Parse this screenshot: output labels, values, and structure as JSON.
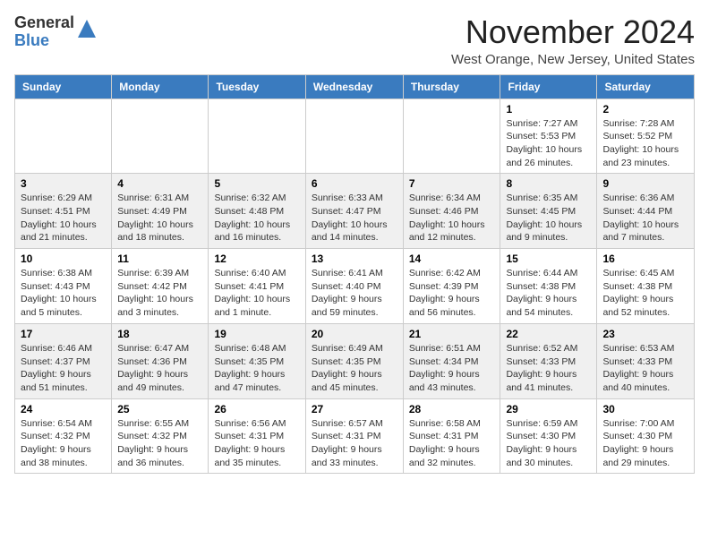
{
  "logo": {
    "line1": "General",
    "line2": "Blue"
  },
  "title": "November 2024",
  "subtitle": "West Orange, New Jersey, United States",
  "days_of_week": [
    "Sunday",
    "Monday",
    "Tuesday",
    "Wednesday",
    "Thursday",
    "Friday",
    "Saturday"
  ],
  "weeks": [
    [
      {
        "day": "",
        "info": ""
      },
      {
        "day": "",
        "info": ""
      },
      {
        "day": "",
        "info": ""
      },
      {
        "day": "",
        "info": ""
      },
      {
        "day": "",
        "info": ""
      },
      {
        "day": "1",
        "info": "Sunrise: 7:27 AM\nSunset: 5:53 PM\nDaylight: 10 hours and 26 minutes."
      },
      {
        "day": "2",
        "info": "Sunrise: 7:28 AM\nSunset: 5:52 PM\nDaylight: 10 hours and 23 minutes."
      }
    ],
    [
      {
        "day": "3",
        "info": "Sunrise: 6:29 AM\nSunset: 4:51 PM\nDaylight: 10 hours and 21 minutes."
      },
      {
        "day": "4",
        "info": "Sunrise: 6:31 AM\nSunset: 4:49 PM\nDaylight: 10 hours and 18 minutes."
      },
      {
        "day": "5",
        "info": "Sunrise: 6:32 AM\nSunset: 4:48 PM\nDaylight: 10 hours and 16 minutes."
      },
      {
        "day": "6",
        "info": "Sunrise: 6:33 AM\nSunset: 4:47 PM\nDaylight: 10 hours and 14 minutes."
      },
      {
        "day": "7",
        "info": "Sunrise: 6:34 AM\nSunset: 4:46 PM\nDaylight: 10 hours and 12 minutes."
      },
      {
        "day": "8",
        "info": "Sunrise: 6:35 AM\nSunset: 4:45 PM\nDaylight: 10 hours and 9 minutes."
      },
      {
        "day": "9",
        "info": "Sunrise: 6:36 AM\nSunset: 4:44 PM\nDaylight: 10 hours and 7 minutes."
      }
    ],
    [
      {
        "day": "10",
        "info": "Sunrise: 6:38 AM\nSunset: 4:43 PM\nDaylight: 10 hours and 5 minutes."
      },
      {
        "day": "11",
        "info": "Sunrise: 6:39 AM\nSunset: 4:42 PM\nDaylight: 10 hours and 3 minutes."
      },
      {
        "day": "12",
        "info": "Sunrise: 6:40 AM\nSunset: 4:41 PM\nDaylight: 10 hours and 1 minute."
      },
      {
        "day": "13",
        "info": "Sunrise: 6:41 AM\nSunset: 4:40 PM\nDaylight: 9 hours and 59 minutes."
      },
      {
        "day": "14",
        "info": "Sunrise: 6:42 AM\nSunset: 4:39 PM\nDaylight: 9 hours and 56 minutes."
      },
      {
        "day": "15",
        "info": "Sunrise: 6:44 AM\nSunset: 4:38 PM\nDaylight: 9 hours and 54 minutes."
      },
      {
        "day": "16",
        "info": "Sunrise: 6:45 AM\nSunset: 4:38 PM\nDaylight: 9 hours and 52 minutes."
      }
    ],
    [
      {
        "day": "17",
        "info": "Sunrise: 6:46 AM\nSunset: 4:37 PM\nDaylight: 9 hours and 51 minutes."
      },
      {
        "day": "18",
        "info": "Sunrise: 6:47 AM\nSunset: 4:36 PM\nDaylight: 9 hours and 49 minutes."
      },
      {
        "day": "19",
        "info": "Sunrise: 6:48 AM\nSunset: 4:35 PM\nDaylight: 9 hours and 47 minutes."
      },
      {
        "day": "20",
        "info": "Sunrise: 6:49 AM\nSunset: 4:35 PM\nDaylight: 9 hours and 45 minutes."
      },
      {
        "day": "21",
        "info": "Sunrise: 6:51 AM\nSunset: 4:34 PM\nDaylight: 9 hours and 43 minutes."
      },
      {
        "day": "22",
        "info": "Sunrise: 6:52 AM\nSunset: 4:33 PM\nDaylight: 9 hours and 41 minutes."
      },
      {
        "day": "23",
        "info": "Sunrise: 6:53 AM\nSunset: 4:33 PM\nDaylight: 9 hours and 40 minutes."
      }
    ],
    [
      {
        "day": "24",
        "info": "Sunrise: 6:54 AM\nSunset: 4:32 PM\nDaylight: 9 hours and 38 minutes."
      },
      {
        "day": "25",
        "info": "Sunrise: 6:55 AM\nSunset: 4:32 PM\nDaylight: 9 hours and 36 minutes."
      },
      {
        "day": "26",
        "info": "Sunrise: 6:56 AM\nSunset: 4:31 PM\nDaylight: 9 hours and 35 minutes."
      },
      {
        "day": "27",
        "info": "Sunrise: 6:57 AM\nSunset: 4:31 PM\nDaylight: 9 hours and 33 minutes."
      },
      {
        "day": "28",
        "info": "Sunrise: 6:58 AM\nSunset: 4:31 PM\nDaylight: 9 hours and 32 minutes."
      },
      {
        "day": "29",
        "info": "Sunrise: 6:59 AM\nSunset: 4:30 PM\nDaylight: 9 hours and 30 minutes."
      },
      {
        "day": "30",
        "info": "Sunrise: 7:00 AM\nSunset: 4:30 PM\nDaylight: 9 hours and 29 minutes."
      }
    ]
  ]
}
